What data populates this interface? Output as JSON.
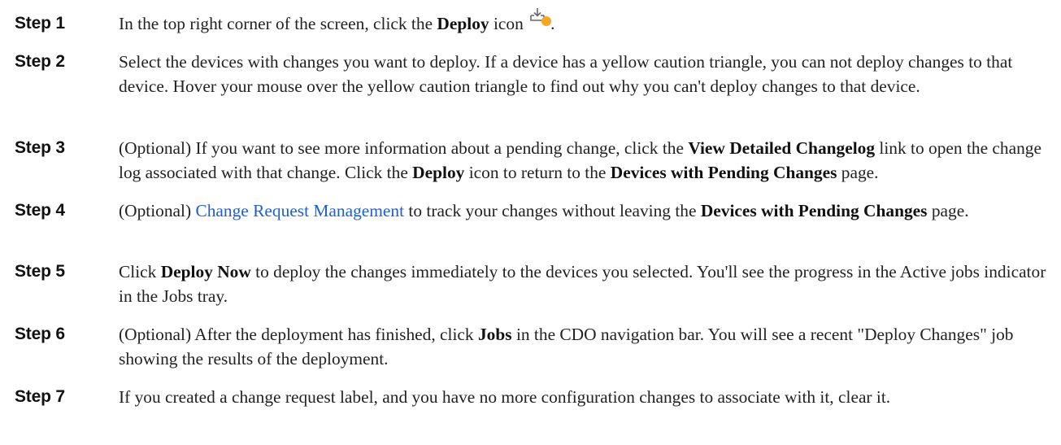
{
  "steps": [
    {
      "label": "Step 1",
      "parts": [
        "In the top right corner of the screen, click the ",
        "Deploy",
        " icon ",
        "."
      ]
    },
    {
      "label": "Step 2",
      "text": "Select the devices with changes you want to deploy. If a device has a yellow caution triangle, you can not deploy changes to that device. Hover your mouse over the yellow caution triangle to find out why you can't deploy changes to that device."
    },
    {
      "label": "Step 3",
      "parts": [
        "(Optional) If you want to see more information about a pending change, click the ",
        "View Detailed Changelog",
        " link to open the change log associated with that change. Click the ",
        "Deploy",
        " icon to return to the ",
        "Devices with Pending Changes",
        " page."
      ]
    },
    {
      "label": "Step 4",
      "parts": [
        "(Optional) ",
        "Change Request Management",
        " to track your changes without leaving the ",
        "Devices with Pending Changes",
        " page."
      ]
    },
    {
      "label": "Step 5",
      "parts": [
        "Click ",
        "Deploy Now",
        " to deploy the changes immediately to the devices you selected. You'll see the progress in the Active jobs indicator in the Jobs tray."
      ]
    },
    {
      "label": "Step 6",
      "parts": [
        "(Optional) After the deployment has finished, click ",
        "Jobs",
        " in the CDO navigation bar. You will see a recent \"Deploy Changes\" job showing the results of the deployment."
      ]
    },
    {
      "label": "Step 7",
      "text": "If you created a change request label, and you have no more configuration changes to associate with it, clear it."
    }
  ],
  "icons": {
    "deploy_icon": "deploy-icon",
    "deploy_icon_dot_color": "#f5a623"
  },
  "colors": {
    "link": "#1f5fcf"
  }
}
